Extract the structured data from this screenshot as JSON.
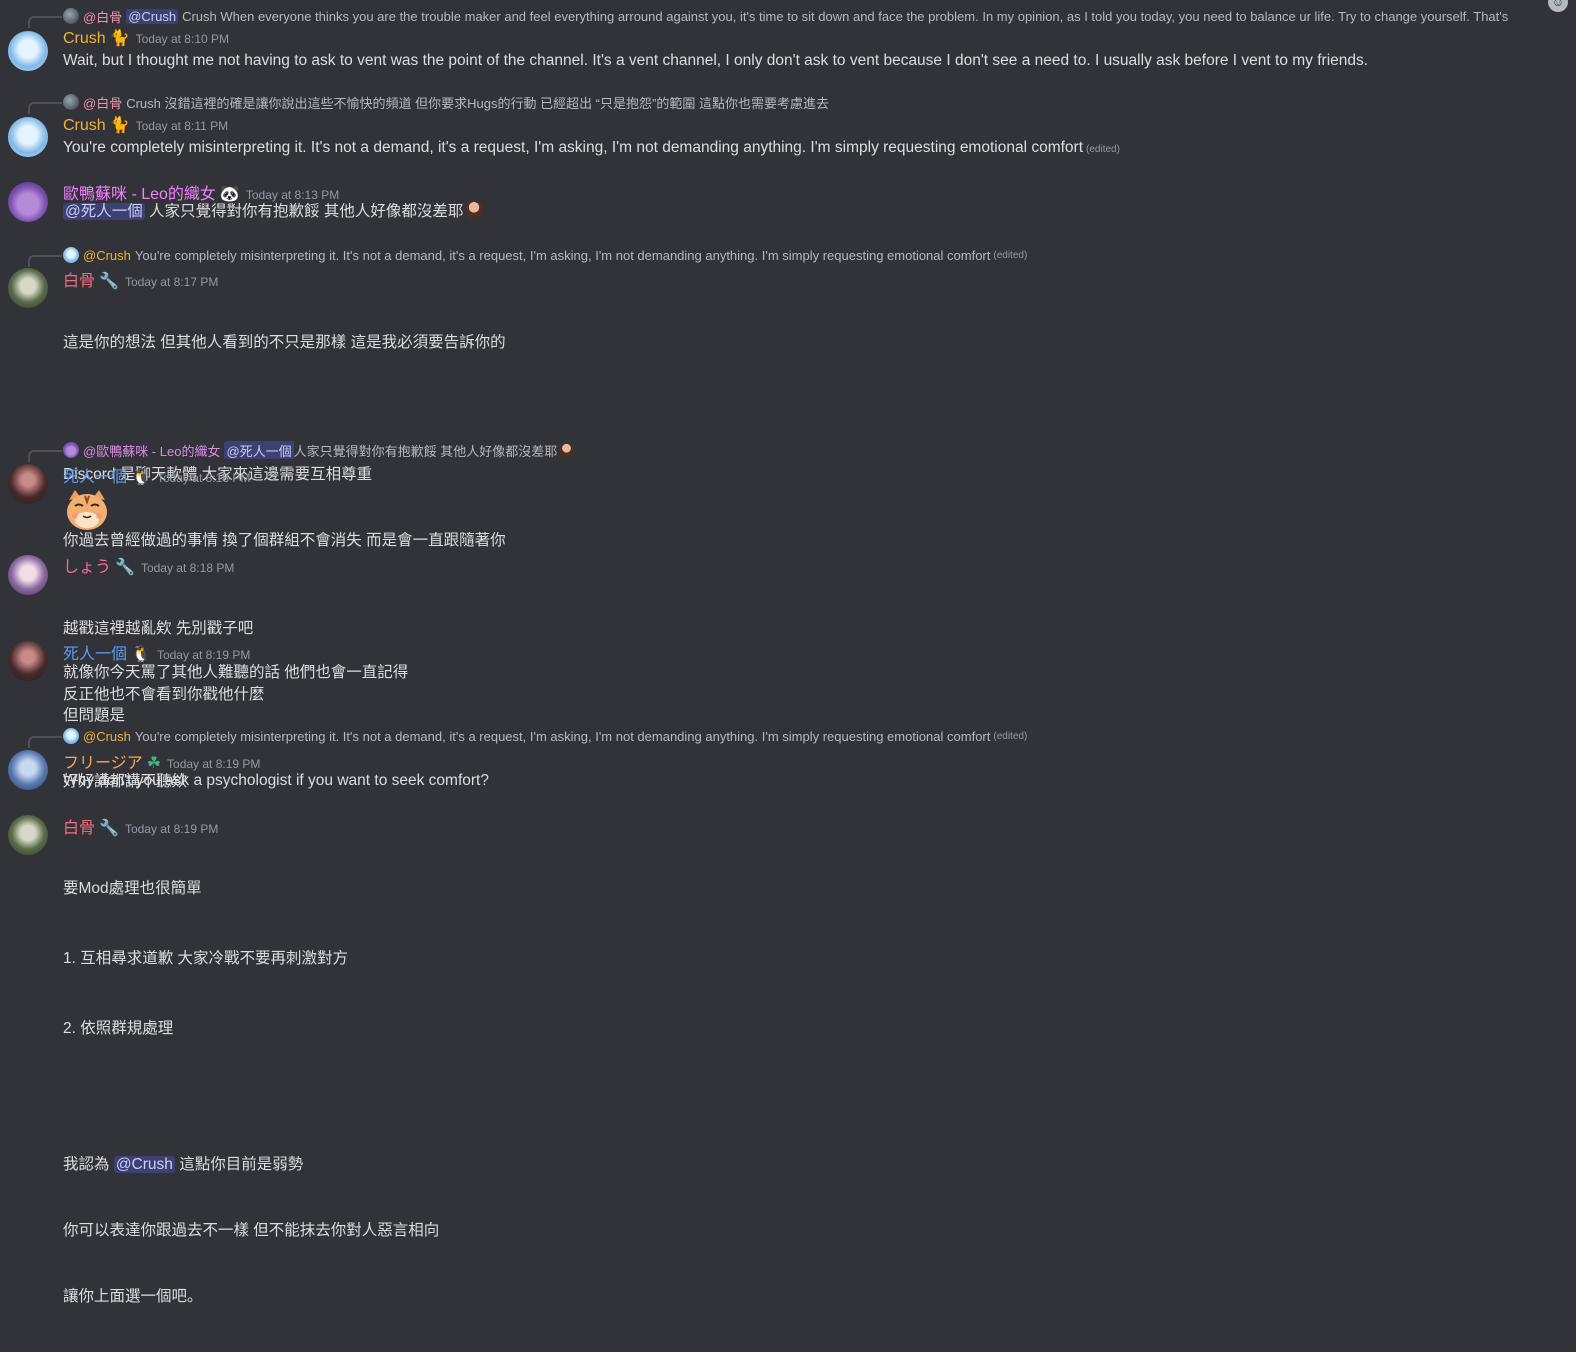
{
  "messages": [
    {
      "reply": {
        "name": "@白骨",
        "mention": "@Crush",
        "text": "Crush  When everyone thinks you are the trouble maker and feel everything arround against you, it's time to sit down and face the problem. In my opinion, as I told you today, you need to balance ur life. Try to change yourself.  That's"
      },
      "username": "Crush",
      "badge": "cat-emoji-icon",
      "timestamp": "Today at 8:10 PM",
      "text": "Wait, but I thought me not having to ask to vent was the point of the channel. It's a vent channel, I only don't ask to vent because I don't see a need to. I usually ask before I vent to my friends."
    },
    {
      "reply": {
        "name": "@白骨",
        "text": "Crush 沒錯這裡的確是讓你說出這些不愉快的頻道 但你要求Hugs的行動 已經超出 “只是抱怨”的範圍 這點你也需要考慮進去"
      },
      "username": "Crush",
      "timestamp": "Today at 8:11 PM",
      "text": "You're completely misinterpreting it. It's not a demand, it's a request, I'm asking, I'm not demanding anything. I'm simply requesting emotional comfort",
      "edited": "(edited)"
    },
    {
      "username": "歐鴨蘇咪 - Leo的織女",
      "timestamp": "Today at 8:13 PM",
      "mention": "@死人一個",
      "text": " 人家只覺得對你有抱歉餒 其他人好像都沒差耶"
    },
    {
      "reply": {
        "name": "@Crush",
        "text": "You're completely misinterpreting it. It's not a demand, it's a request, I'm asking, I'm not demanding anything. I'm simply requesting emotional comfort",
        "edited": "(edited)"
      },
      "username": "白骨",
      "timestamp": "Today at 8:17 PM",
      "lines": [
        "這是你的想法 但其他人看到的不只是那樣 這是我必須要告訴你的",
        "",
        "Discord 是聊天軟體 大家來這邊需要互相尊重",
        "你過去曾經做過的事情 換了個群組不會消失 而是會一直跟隨著你",
        "",
        "就像你今天罵了其他人難聽的話 他們也會一直記得"
      ]
    },
    {
      "reply": {
        "name": "@歐鴨蘇咪 - Leo的織女",
        "mention": "@死人一個",
        "text": " 人家只覺得對你有抱歉餒 其他人好像都沒差耶"
      },
      "username": "死人一個",
      "timestamp": "Today at 8:18 PM"
    },
    {
      "username": "しょう",
      "timestamp": "Today at 8:18 PM",
      "lines": [
        "越戳這裡越亂欸 先別戳子吧",
        "反正他也不會看到你戳他什麼"
      ]
    },
    {
      "username": "死人一個",
      "timestamp": "Today at 8:19 PM",
      "lines": [
        "但問題是",
        "好好講都講不聽欸"
      ]
    },
    {
      "reply": {
        "name": "@Crush",
        "text": "You're completely misinterpreting it. It's not a demand, it's a request, I'm asking, I'm not demanding anything. I'm simply requesting emotional comfort",
        "edited": "(edited)"
      },
      "username": "フリージア",
      "timestamp": "Today at 8:19 PM",
      "text": "Why don't you ask a psychologist if you want to seek comfort?"
    },
    {
      "username": "白骨",
      "timestamp": "Today at 8:19 PM",
      "lines": [
        "要Mod處理也很簡單",
        "1. 互相尋求道歉 大家冷戰不要再刺激對方",
        "2. 依照群規處理",
        "",
        "我認為 ",
        "你可以表達你跟過去不一樣 但不能抹去你對人惡言相向",
        "讓你上面選一個吧。"
      ],
      "mention": "@Crush",
      "after_mention": " 這點你目前是弱勢"
    }
  ]
}
